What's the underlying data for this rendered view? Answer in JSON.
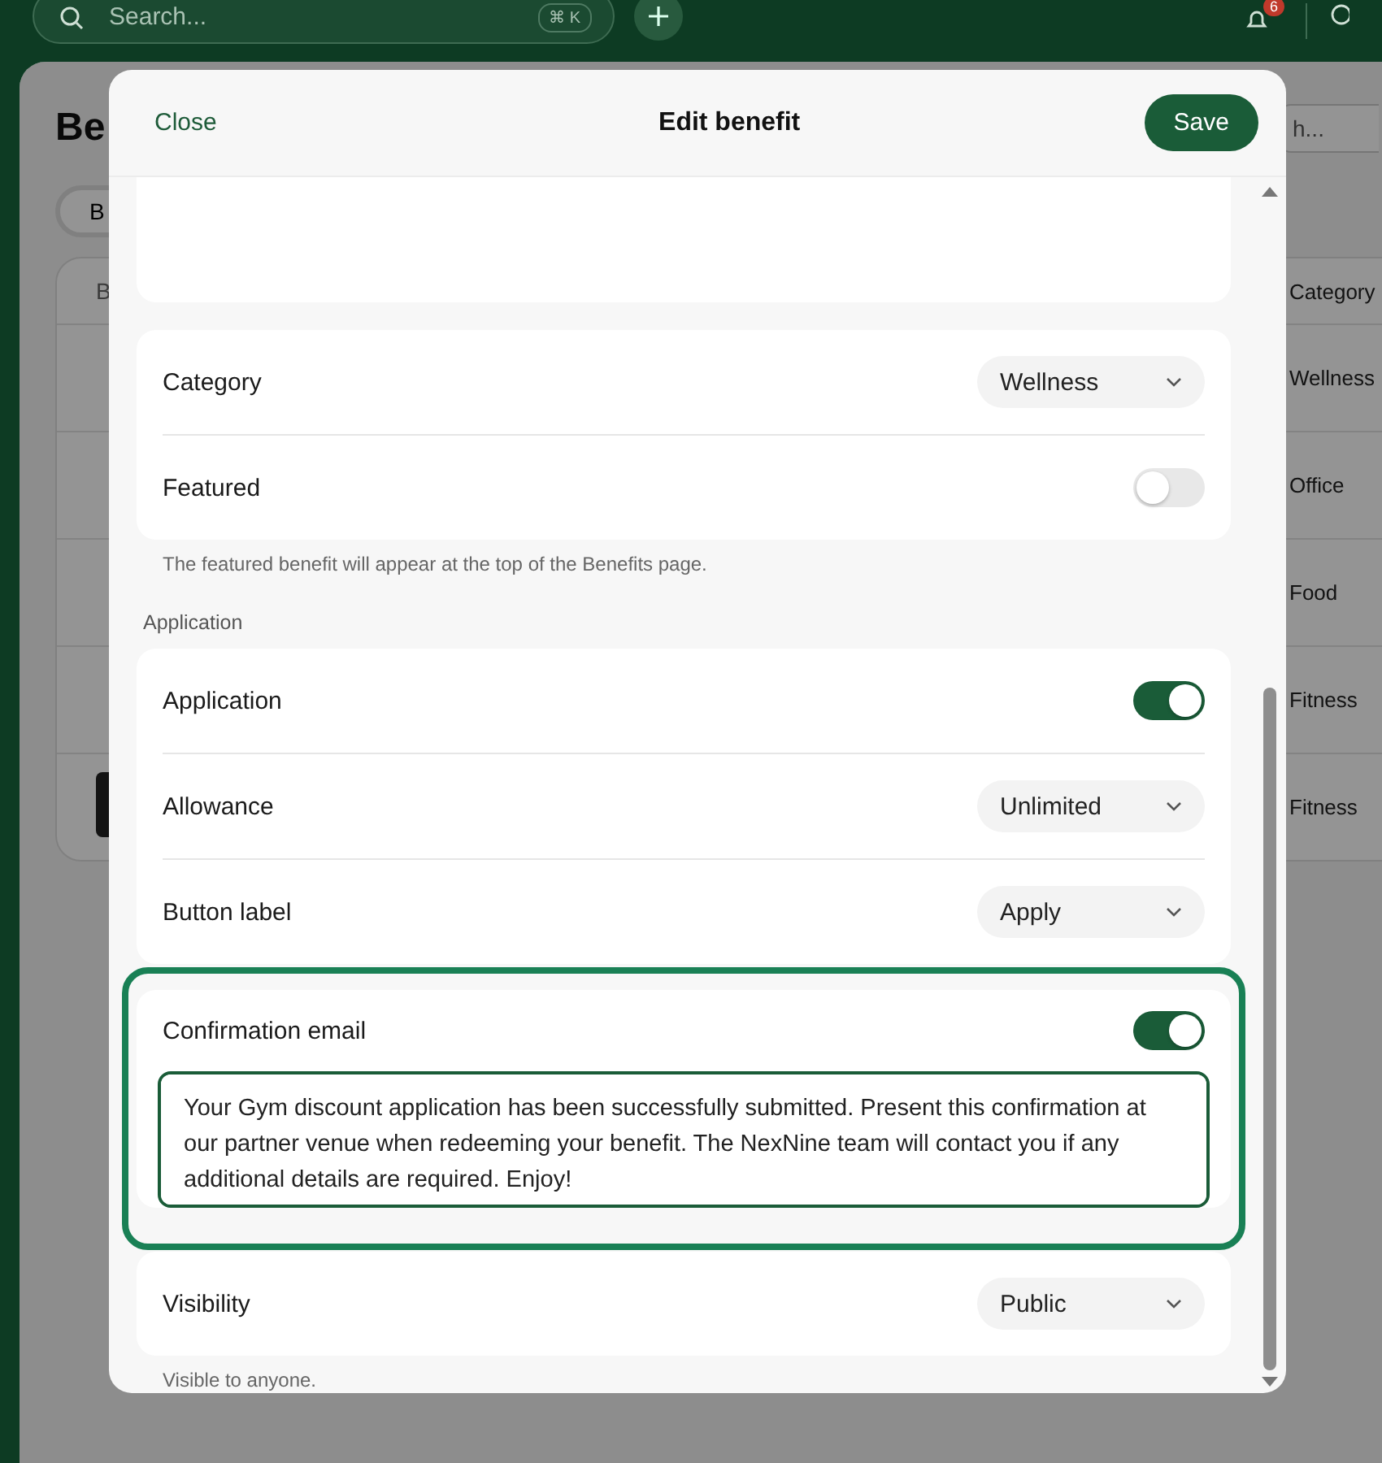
{
  "top_bar": {
    "search": {
      "placeholder": "Search..."
    },
    "shortcut": "⌘ K",
    "notification_count": "6"
  },
  "page": {
    "title": "Be",
    "filter_chip": "B",
    "search": {
      "placeholder": "h..."
    },
    "table": {
      "columns": [
        "B",
        "Category"
      ],
      "rows": [
        {
          "category": "Wellness"
        },
        {
          "category": "Office"
        },
        {
          "category": "Food"
        },
        {
          "category": "Fitness"
        },
        {
          "category": "Fitness"
        }
      ]
    }
  },
  "dialog": {
    "close": "Close",
    "title": "Edit benefit",
    "save": "Save",
    "blocks": [
      {
        "kind": "blank_card"
      },
      {
        "kind": "card",
        "highlighted": false,
        "rows": [
          {
            "kind": "select",
            "label": "Category",
            "value": "Wellness"
          },
          {
            "kind": "toggle",
            "label": "Featured",
            "on": false
          }
        ]
      },
      {
        "kind": "hint",
        "text": "The featured benefit will appear at the top of the Benefits page."
      },
      {
        "kind": "section_label",
        "text": "Application"
      },
      {
        "kind": "card",
        "highlighted": false,
        "rows": [
          {
            "kind": "toggle",
            "label": "Application",
            "on": true
          },
          {
            "kind": "select",
            "label": "Allowance",
            "value": "Unlimited"
          },
          {
            "kind": "select",
            "label": "Button label",
            "value": "Apply"
          }
        ]
      },
      {
        "kind": "card",
        "highlighted": true,
        "rows": [
          {
            "kind": "toggle_text",
            "label": "Confirmation email",
            "on": true,
            "value": "Your Gym discount application has been successfully submitted. Present this confirmation at our partner venue when redeeming your benefit. The NexNine team will contact you if any additional details are required. Enjoy!"
          }
        ]
      },
      {
        "kind": "card",
        "highlighted": false,
        "rows": [
          {
            "kind": "select",
            "label": "Visibility",
            "value": "Public"
          }
        ]
      },
      {
        "kind": "hint",
        "text": "Visible to anyone."
      }
    ]
  }
}
